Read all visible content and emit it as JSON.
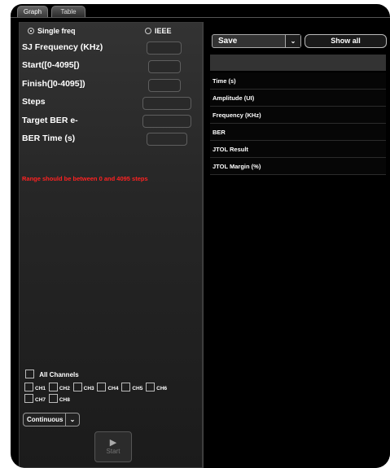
{
  "tabs": [
    "Graph",
    "Table"
  ],
  "modes": {
    "single_freq": "Single freq",
    "ieee": "IEEE",
    "selected": "single_freq"
  },
  "fields": [
    {
      "label": "SJ Frequency (KHz)",
      "value": ""
    },
    {
      "label": "Start([0-4095[)",
      "value": ""
    },
    {
      "label": "Finish(]0-4095])",
      "value": ""
    },
    {
      "label": "Steps",
      "value": ""
    },
    {
      "label": "Target BER e-",
      "value": ""
    },
    {
      "label": "BER Time (s)",
      "value": ""
    }
  ],
  "error": "Range should be between 0 and 4095 steps",
  "channels": {
    "all_label": "All Channels",
    "items": [
      "CH1",
      "CH2",
      "CH3",
      "CH4",
      "CH5",
      "CH6",
      "CH7",
      "CH8"
    ]
  },
  "mode_select": "Continuous",
  "start_label": "Start",
  "right": {
    "save_label": "Save",
    "show_all_label": "Show all",
    "rows": [
      "Time (s)",
      "Amplitude (UI)",
      "Frequency (KHz)",
      "BER",
      "JTOL Result",
      "JTOL Margin (%)"
    ]
  },
  "colors": {
    "error": "#ff2222",
    "background": "#000000"
  }
}
